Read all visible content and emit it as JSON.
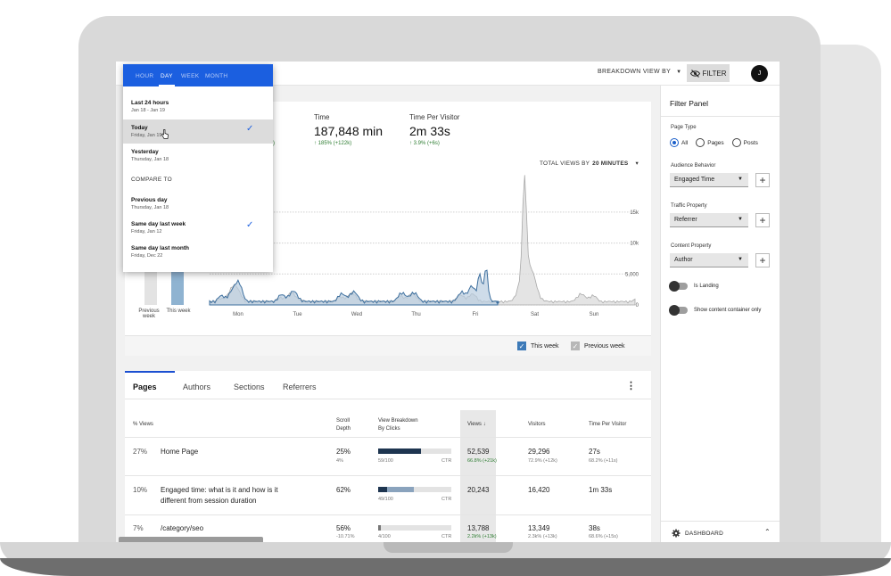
{
  "topbar": {
    "breakdown_label": "BREAKDOWN VIEW BY",
    "filter_label": "FILTER",
    "avatar_initial": "J"
  },
  "metrics": [
    {
      "label": "Time",
      "value": "187,848 min",
      "delta": "185% (+122k)"
    },
    {
      "label": "Time Per Visitor",
      "value": "2m 33s",
      "delta": "3.9% (+6s)"
    }
  ],
  "partial_delta": ")",
  "total_views": {
    "label": "TOTAL VIEWS BY",
    "value": "20 MINUTES"
  },
  "chart_data": {
    "type": "area",
    "x_ticks": [
      "Mon",
      "Tue",
      "Wed",
      "Thu",
      "Fri",
      "Sat",
      "Sun"
    ],
    "y_ticks": [
      "15k",
      "10k",
      "5,000",
      "0"
    ],
    "ylim": [
      0,
      17000
    ],
    "series": [
      {
        "name": "This week",
        "color": "#3d7ab8"
      },
      {
        "name": "Previous week",
        "color": "#b7b7b7"
      }
    ],
    "week_compare": {
      "labels": [
        "Previous week",
        "This week"
      ]
    }
  },
  "legend": {
    "this_week": "This week",
    "previous_week": "Previous week"
  },
  "table": {
    "tabs": [
      "Pages",
      "Authors",
      "Sections",
      "Referrers"
    ],
    "headers": {
      "views_pct": "% Views",
      "scroll_depth_1": "Scroll",
      "scroll_depth_2": "Depth",
      "breakdown_1": "View Breakdown",
      "breakdown_2": "By Clicks",
      "views": "Views ↓",
      "visitors": "Visitors",
      "tpv": "Time Per Visitor"
    },
    "rows": [
      {
        "pct": "27%",
        "title1": "Home Page",
        "title2": "",
        "scroll": "25%",
        "scroll_sub": "4%",
        "clicks": "59/100",
        "ctr": "CTR",
        "views": "52,539",
        "views_sub": "66.8% (+21k)",
        "visitors": "29,296",
        "visitors_sub": "72.9% (+12k)",
        "tpv": "27s",
        "tpv_sub": "68.2% (+11s)",
        "fill": 0.59,
        "mid": 0.0
      },
      {
        "pct": "10%",
        "title1": "Engaged time: what is it and how is it",
        "title2": "different from session duration",
        "scroll": "62%",
        "scroll_sub": "",
        "clicks": "49/100",
        "ctr": "CTR",
        "views": "20,243",
        "views_sub": "",
        "visitors": "16,420",
        "visitors_sub": "",
        "tpv": "1m 33s",
        "tpv_sub": "",
        "fill": 0.12,
        "mid": 0.37
      },
      {
        "pct": "7%",
        "title1": "/category/seo",
        "title2": "",
        "scroll": "56%",
        "scroll_sub": "-10.71%",
        "clicks": "4/100",
        "ctr": "CTR",
        "views": "13,788",
        "views_sub": "2.2k% (+13k)",
        "visitors": "13,349",
        "visitors_sub": "2.3k% (+13k)",
        "tpv": "38s",
        "tpv_sub": "68.6% (+15s)",
        "fill": 0.04,
        "mid": 0.0
      }
    ]
  },
  "panel": {
    "title": "Filter Panel",
    "page_type_label": "Page Type",
    "page_type_options": [
      "All",
      "Pages",
      "Posts"
    ],
    "audience_label": "Audience Behavior",
    "audience_value": "Engaged Time",
    "traffic_label": "Traffic Property",
    "traffic_value": "Referrer",
    "content_label": "Content Property",
    "content_value": "Author",
    "toggle_landing": "Is Landing",
    "toggle_container": "Show content container only",
    "footer": "DASHBOARD"
  },
  "dropdown": {
    "tabs": [
      "HOUR",
      "DAY",
      "WEEK",
      "MONTH"
    ],
    "items": [
      {
        "title": "Last 24 hours",
        "sub": "Jan 18 - Jan 19"
      },
      {
        "title": "Today",
        "sub": "Friday, Jan 19"
      },
      {
        "title": "Yesterday",
        "sub": "Thursday, Jan 18"
      }
    ],
    "compare_label": "COMPARE TO",
    "compare_items": [
      {
        "title": "Previous day",
        "sub": "Thursday, Jan 18"
      },
      {
        "title": "Same day last week",
        "sub": "Friday, Jan 12"
      },
      {
        "title": "Same day last month",
        "sub": "Friday, Dec 22"
      }
    ]
  }
}
